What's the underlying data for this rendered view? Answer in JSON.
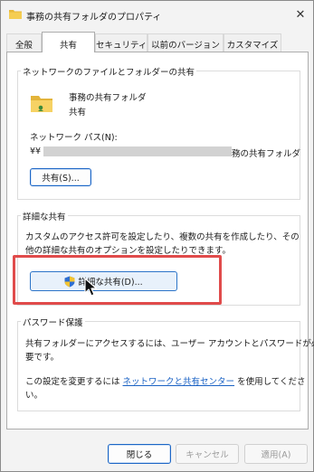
{
  "window": {
    "title": "事務の共有フォルダのプロパティ",
    "close_label": "✕"
  },
  "tabs": [
    {
      "label": "全般"
    },
    {
      "label": "共有"
    },
    {
      "label": "セキュリティ"
    },
    {
      "label": "以前のバージョン"
    },
    {
      "label": "カスタマイズ"
    }
  ],
  "network_share": {
    "group_title": "ネットワークのファイルとフォルダーの共有",
    "folder_name": "事務の共有フォルダ",
    "status": "共有",
    "path_label": "ネットワーク パス(N):",
    "path_prefix": "¥¥",
    "path_suffix": "務の共有フォルダ",
    "share_button": "共有(S)..."
  },
  "advanced_share": {
    "group_title": "詳細な共有",
    "description_line1": "カスタムのアクセス許可を設定したり、複数の共有を作成したり、その",
    "description_line2": "他の詳細な共有のオプションを設定したりできます。",
    "button": "詳細な共有(D)..."
  },
  "password": {
    "group_title": "パスワード保護",
    "line1": "共有フォルダーにアクセスするには、ユーザー アカウントとパスワードが必",
    "line2": "要です。",
    "line3_prefix": "この設定を変更するには ",
    "link": "ネットワークと共有センター",
    "line3_suffix": " を使用してくださ",
    "line4": "い。"
  },
  "footer": {
    "close": "閉じる",
    "cancel": "キャンセル",
    "apply": "適用(A)"
  },
  "colors": {
    "highlight": "#e04b4b",
    "link": "#1a62c4",
    "folder": "#f2c94c"
  }
}
